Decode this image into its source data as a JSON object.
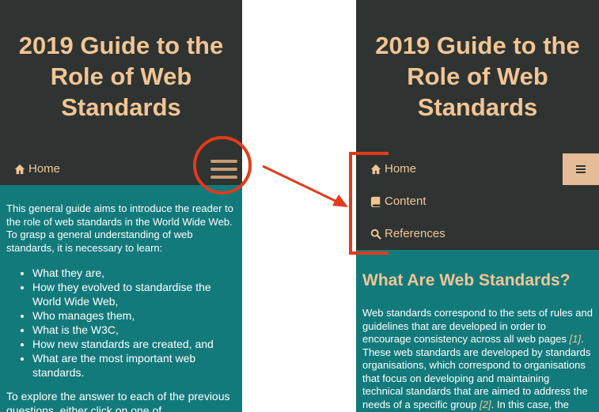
{
  "left": {
    "title": "2019 Guide to the Role of Web Standards",
    "nav": {
      "home": "Home"
    },
    "intro": "This general guide aims to introduce the reader to the role of web standards in the World Wide Web. To grasp a general understanding of web standards, it is necessary to learn:",
    "list": [
      "What they are,",
      "How they evolved to standardise the World Wide Web,",
      "Who manages them,",
      "What is the W3C,",
      "How new standards are created, and",
      "What are the most important web standards."
    ],
    "outro": "To explore the answer to each of the previous questions, either click on one of"
  },
  "right": {
    "title": "2019 Guide to the Role of Web Standards",
    "nav": {
      "home": "Home",
      "content": "Content",
      "references": "References"
    },
    "section_title": "What Are Web Standards?",
    "para_part1": "Web standards correspond to the sets of rules and guidelines that are developed in order to encourage consistency across all web pages ",
    "cite1": "[1]",
    "para_part2": ". These web standards are developed by standards organisations, which correspond to organisations that focus on developing and maintaining technical standards that are aimed to address the needs of a specific group ",
    "cite2": "[2]",
    "para_part3": ". In this case, the"
  },
  "colors": {
    "header_bg": "#2f3432",
    "accent_text": "#f3c594",
    "content_bg": "#137a7c",
    "annotation_red": "#e23b1a",
    "hamburger_btn_bg": "#e5bb98"
  },
  "icons": [
    "home-icon",
    "book-icon",
    "search-icon",
    "hamburger-icon"
  ]
}
